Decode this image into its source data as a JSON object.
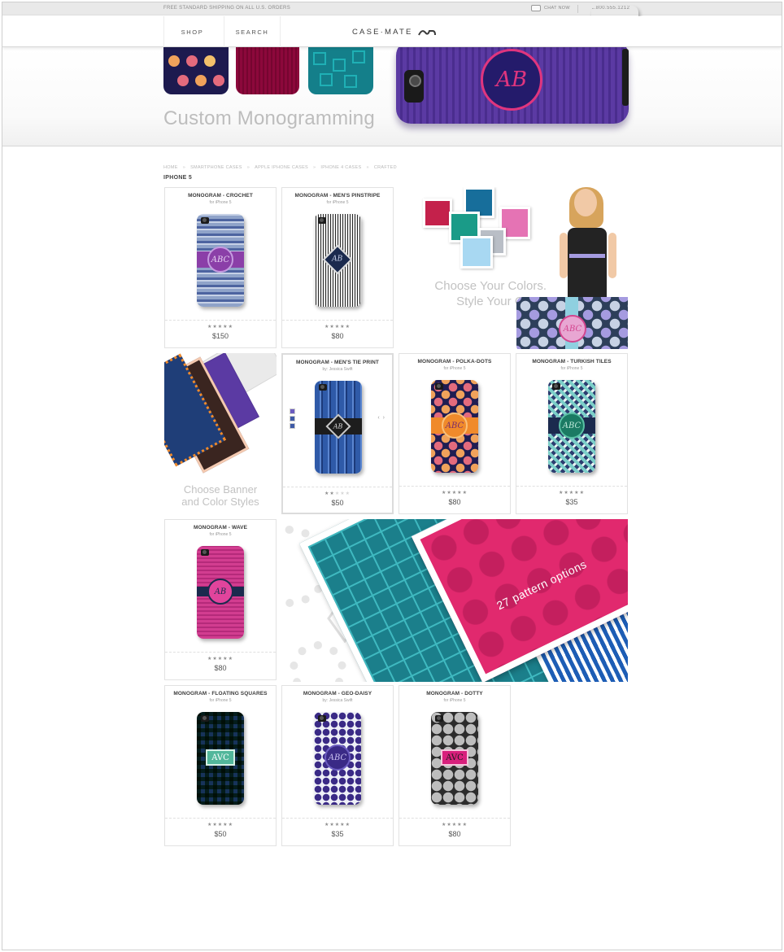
{
  "utility": {
    "shipping": "FREE STANDARD SHIPPING ON ALL U.S. ORDERS",
    "chat": "CHAT NOW",
    "phone": "1.800.555.1212"
  },
  "nav": {
    "shop": "SHOP",
    "search": "SEARCH",
    "logo_text": "CASE·MATE"
  },
  "hero": {
    "title": "Custom Monogramming",
    "monogram": "AB"
  },
  "breadcrumb": [
    "HOME",
    "SMARTPHONE CASES",
    "APPLE IPHONE CASES",
    "IPHONE 4 CASES",
    "CRAFTED"
  ],
  "breadcrumb_sep": "»",
  "section_title": "IPHONE 5",
  "products": [
    {
      "name": "MONOGRAM - CROCHET",
      "sub": "for iPhone 5",
      "stars": "★★★★★",
      "price": "$150",
      "mono": "ABC"
    },
    {
      "name": "MONOGRAM - MEN'S PINSTRIPE",
      "sub": "for iPhone 5",
      "stars": "★★★★★",
      "price": "$80",
      "mono": "AB"
    },
    {
      "name": "MONOGRAM - MEN'S TIE PRINT",
      "sub": "by: Jessica Swift",
      "stars_on": "★★",
      "stars_off": "★★★",
      "price": "$50",
      "mono": "AB",
      "arrows": "‹ ›"
    },
    {
      "name": "MONOGRAM - POLKA-DOTS",
      "sub": "for iPhone 5",
      "stars": "★★★★★",
      "price": "$80",
      "mono": "ABC"
    },
    {
      "name": "MONOGRAM - TURKISH TILES",
      "sub": "for iPhone 5",
      "stars": "★★★★★",
      "price": "$35",
      "mono": "ABC"
    },
    {
      "name": "MONOGRAM - WAVE",
      "sub": "for iPhone 5",
      "stars": "★★★★★",
      "price": "$80",
      "mono": "AB"
    },
    {
      "name": "MONOGRAM - FLOATING SQUARES",
      "sub": "for iPhone 5",
      "stars": "★★★★★",
      "price": "$50",
      "mono": "AVC"
    },
    {
      "name": "MONOGRAM - GEO-DAISY",
      "sub": "by: Jessica Swift",
      "stars": "★★★★★",
      "price": "$35",
      "mono": "ABC"
    },
    {
      "name": "MONOGRAM - DOTTY",
      "sub": "for iPhone 5",
      "stars": "★★★★★",
      "price": "$80",
      "mono": "AVC"
    }
  ],
  "promos": {
    "colors_line1": "Choose Your Colors.",
    "colors_line2": "Style Your Case.",
    "banner_line1": "Choose Banner",
    "banner_line2": "and Color Styles",
    "patterns": "27 pattern options",
    "mini_mono": "ABC"
  },
  "colors": {
    "accent_pink": "#e1296e",
    "accent_teal": "#1b7f8b",
    "accent_purple": "#5b3aa3"
  }
}
